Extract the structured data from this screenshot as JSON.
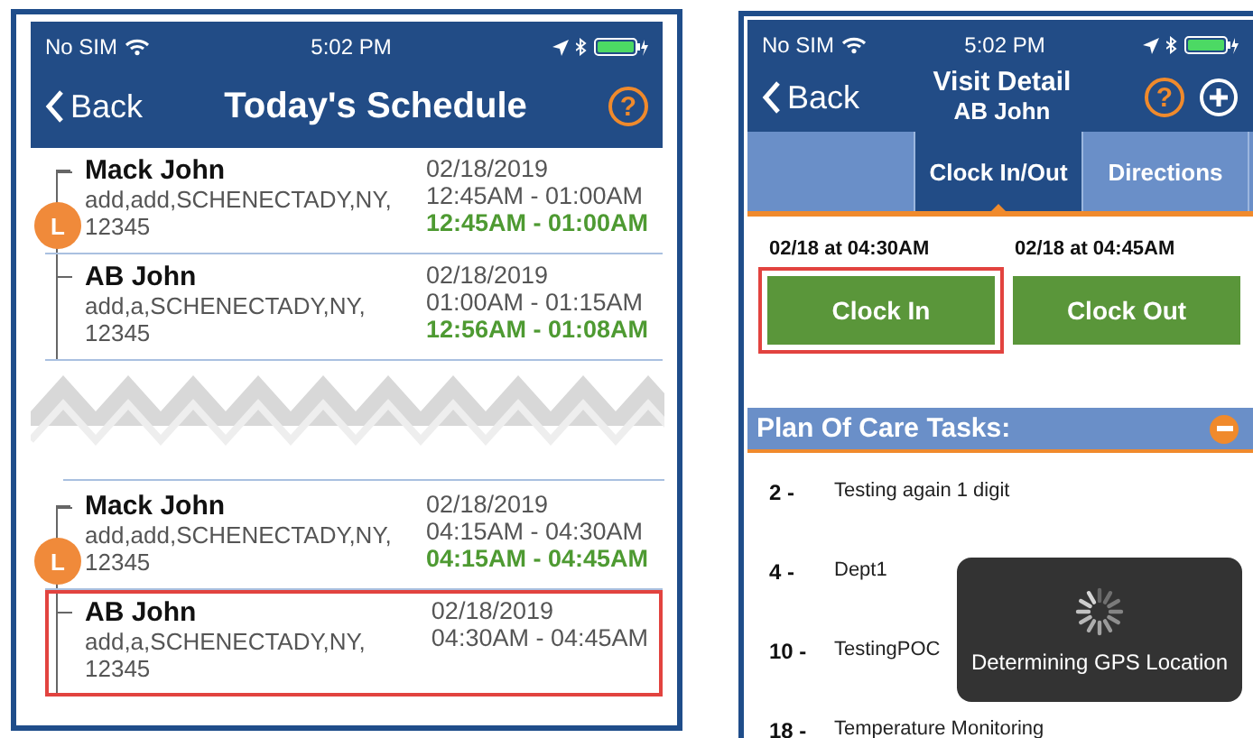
{
  "left_phone": {
    "status_bar": {
      "carrier": "No SIM",
      "time": "5:02 PM"
    },
    "nav": {
      "back": "Back",
      "title": "Today's Schedule",
      "help": "?"
    },
    "schedule": [
      {
        "kind": "group",
        "badge": "L",
        "rows": [
          {
            "name": "Mack John",
            "address": "add,add,SCHENECTADY,NY, 12345",
            "date": "02/18/2019",
            "scheduled": "12:45AM - 01:00AM",
            "actual": "12:45AM - 01:00AM",
            "highlighted": false
          },
          {
            "name": "AB John",
            "address": "add,a,SCHENECTADY,NY, 12345",
            "date": "02/18/2019",
            "scheduled": "01:00AM - 01:15AM",
            "actual": "12:56AM - 01:08AM",
            "highlighted": false
          }
        ]
      },
      {
        "kind": "tear"
      },
      {
        "kind": "group",
        "badge": "L",
        "rows": [
          {
            "name": "Mack John",
            "address": "add,add,SCHENECTADY,NY, 12345",
            "date": "02/18/2019",
            "scheduled": "04:15AM - 04:30AM",
            "actual": "04:15AM - 04:45AM",
            "highlighted": false
          },
          {
            "name": "AB John",
            "address": "add,a,SCHENECTADY,NY, 12345",
            "date": "02/18/2019",
            "scheduled": "04:30AM - 04:45AM",
            "highlighted": true
          }
        ]
      }
    ]
  },
  "right_phone": {
    "status_bar": {
      "carrier": "No SIM",
      "time": "5:02 PM"
    },
    "nav": {
      "back": "Back",
      "title": "Visit Detail",
      "subtitle": "AB John",
      "help": "?"
    },
    "tabs": [
      {
        "selected": false
      },
      {
        "label": "Clock In/Out",
        "selected": true
      },
      {
        "label": "Directions",
        "selected": false
      }
    ],
    "clock": [
      {
        "time": "02/18 at 04:30AM",
        "button": "Clock In",
        "highlighted": true
      },
      {
        "time": "02/18 at 04:45AM",
        "button": "Clock Out",
        "highlighted": false
      }
    ],
    "plan_of_care": {
      "title": "Plan Of Care Tasks:",
      "expanded": true,
      "tasks": [
        {
          "number": "2 -",
          "name": "Testing again 1 digit"
        },
        {
          "number": "4 -",
          "name": "Dept1"
        },
        {
          "number": "10 -",
          "name": "TestingPOC"
        },
        {
          "number": "18 -",
          "name": "Temperature Monitoring"
        }
      ]
    },
    "toast": {
      "message": "Determining GPS Location"
    }
  }
}
